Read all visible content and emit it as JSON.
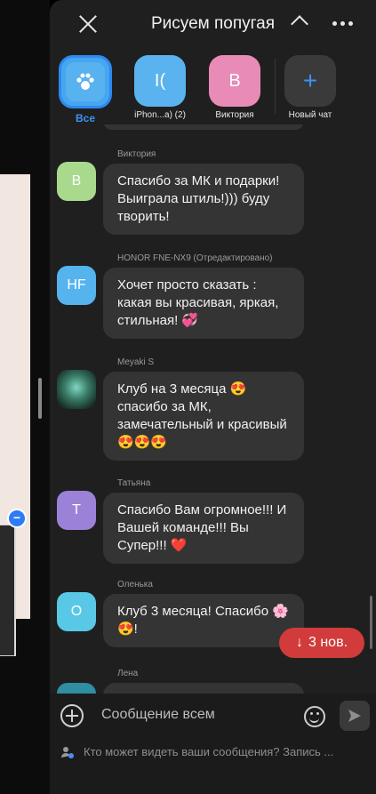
{
  "header": {
    "title": "Рисуем попугая"
  },
  "filters": [
    {
      "label": "Все",
      "selected": true,
      "icon": "paw-icon",
      "color": "#46a6ee"
    },
    {
      "label": "iPhon...а) (2)",
      "avatar": "I(",
      "color": "#5ab3ee"
    },
    {
      "label": "Виктория",
      "avatar": "В",
      "color": "#e88bb6"
    },
    {
      "label": "Новый чат",
      "avatar": "+",
      "color": "#3a3a3a"
    }
  ],
  "messages": [
    {
      "sender": "Виктория",
      "avatar": "В",
      "color": "#a9d98d",
      "text": "Спасибо за МК и подарки! Выиграла штиль!))) буду творить!"
    },
    {
      "sender": "HONOR FNE-NX9  (Отредактировано)",
      "avatar": "HF",
      "color": "#55b3ee",
      "text": "Хочет просто сказать : какая вы красивая, яркая, стильная! 💞"
    },
    {
      "sender": "Meyaki S",
      "avatar": "",
      "color": "#2b5a4a",
      "text": "Клуб на 3 месяца 😍 спасибо за МК, замечательный и красивый 😍😍😍"
    },
    {
      "sender": "Татьяна",
      "avatar": "Т",
      "color": "#9b82d8",
      "text": "Спасибо Вам огромное!!! И Вашей команде!!! Вы Супер!!! ❤️"
    },
    {
      "sender": "Оленька",
      "avatar": "О",
      "color": "#59c8e6",
      "text": "Клуб 3 месяца! Спасибо 🌸😍!"
    },
    {
      "sender": "Лена",
      "avatar": "",
      "color": "#2f8ea2",
      "text": ""
    }
  ],
  "new_pill": "3 нов.",
  "composer": {
    "placeholder": "Сообщение всем",
    "note": "Кто может видеть ваши сообщения? Запись ..."
  }
}
